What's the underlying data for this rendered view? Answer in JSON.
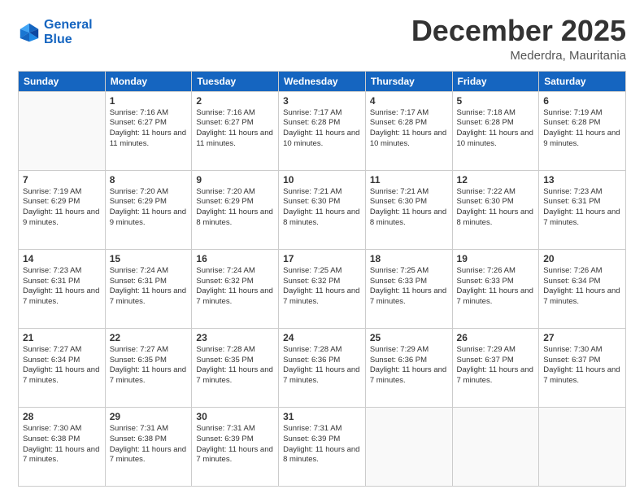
{
  "header": {
    "logo_line1": "General",
    "logo_line2": "Blue",
    "month": "December 2025",
    "location": "Mederdra, Mauritania"
  },
  "weekdays": [
    "Sunday",
    "Monday",
    "Tuesday",
    "Wednesday",
    "Thursday",
    "Friday",
    "Saturday"
  ],
  "weeks": [
    [
      {
        "day": "",
        "info": ""
      },
      {
        "day": "1",
        "info": "Sunrise: 7:16 AM\nSunset: 6:27 PM\nDaylight: 11 hours\nand 11 minutes."
      },
      {
        "day": "2",
        "info": "Sunrise: 7:16 AM\nSunset: 6:27 PM\nDaylight: 11 hours\nand 11 minutes."
      },
      {
        "day": "3",
        "info": "Sunrise: 7:17 AM\nSunset: 6:28 PM\nDaylight: 11 hours\nand 10 minutes."
      },
      {
        "day": "4",
        "info": "Sunrise: 7:17 AM\nSunset: 6:28 PM\nDaylight: 11 hours\nand 10 minutes."
      },
      {
        "day": "5",
        "info": "Sunrise: 7:18 AM\nSunset: 6:28 PM\nDaylight: 11 hours\nand 10 minutes."
      },
      {
        "day": "6",
        "info": "Sunrise: 7:19 AM\nSunset: 6:28 PM\nDaylight: 11 hours\nand 9 minutes."
      }
    ],
    [
      {
        "day": "7",
        "info": "Sunrise: 7:19 AM\nSunset: 6:29 PM\nDaylight: 11 hours\nand 9 minutes."
      },
      {
        "day": "8",
        "info": "Sunrise: 7:20 AM\nSunset: 6:29 PM\nDaylight: 11 hours\nand 9 minutes."
      },
      {
        "day": "9",
        "info": "Sunrise: 7:20 AM\nSunset: 6:29 PM\nDaylight: 11 hours\nand 8 minutes."
      },
      {
        "day": "10",
        "info": "Sunrise: 7:21 AM\nSunset: 6:30 PM\nDaylight: 11 hours\nand 8 minutes."
      },
      {
        "day": "11",
        "info": "Sunrise: 7:21 AM\nSunset: 6:30 PM\nDaylight: 11 hours\nand 8 minutes."
      },
      {
        "day": "12",
        "info": "Sunrise: 7:22 AM\nSunset: 6:30 PM\nDaylight: 11 hours\nand 8 minutes."
      },
      {
        "day": "13",
        "info": "Sunrise: 7:23 AM\nSunset: 6:31 PM\nDaylight: 11 hours\nand 7 minutes."
      }
    ],
    [
      {
        "day": "14",
        "info": "Sunrise: 7:23 AM\nSunset: 6:31 PM\nDaylight: 11 hours\nand 7 minutes."
      },
      {
        "day": "15",
        "info": "Sunrise: 7:24 AM\nSunset: 6:31 PM\nDaylight: 11 hours\nand 7 minutes."
      },
      {
        "day": "16",
        "info": "Sunrise: 7:24 AM\nSunset: 6:32 PM\nDaylight: 11 hours\nand 7 minutes."
      },
      {
        "day": "17",
        "info": "Sunrise: 7:25 AM\nSunset: 6:32 PM\nDaylight: 11 hours\nand 7 minutes."
      },
      {
        "day": "18",
        "info": "Sunrise: 7:25 AM\nSunset: 6:33 PM\nDaylight: 11 hours\nand 7 minutes."
      },
      {
        "day": "19",
        "info": "Sunrise: 7:26 AM\nSunset: 6:33 PM\nDaylight: 11 hours\nand 7 minutes."
      },
      {
        "day": "20",
        "info": "Sunrise: 7:26 AM\nSunset: 6:34 PM\nDaylight: 11 hours\nand 7 minutes."
      }
    ],
    [
      {
        "day": "21",
        "info": "Sunrise: 7:27 AM\nSunset: 6:34 PM\nDaylight: 11 hours\nand 7 minutes."
      },
      {
        "day": "22",
        "info": "Sunrise: 7:27 AM\nSunset: 6:35 PM\nDaylight: 11 hours\nand 7 minutes."
      },
      {
        "day": "23",
        "info": "Sunrise: 7:28 AM\nSunset: 6:35 PM\nDaylight: 11 hours\nand 7 minutes."
      },
      {
        "day": "24",
        "info": "Sunrise: 7:28 AM\nSunset: 6:36 PM\nDaylight: 11 hours\nand 7 minutes."
      },
      {
        "day": "25",
        "info": "Sunrise: 7:29 AM\nSunset: 6:36 PM\nDaylight: 11 hours\nand 7 minutes."
      },
      {
        "day": "26",
        "info": "Sunrise: 7:29 AM\nSunset: 6:37 PM\nDaylight: 11 hours\nand 7 minutes."
      },
      {
        "day": "27",
        "info": "Sunrise: 7:30 AM\nSunset: 6:37 PM\nDaylight: 11 hours\nand 7 minutes."
      }
    ],
    [
      {
        "day": "28",
        "info": "Sunrise: 7:30 AM\nSunset: 6:38 PM\nDaylight: 11 hours\nand 7 minutes."
      },
      {
        "day": "29",
        "info": "Sunrise: 7:31 AM\nSunset: 6:38 PM\nDaylight: 11 hours\nand 7 minutes."
      },
      {
        "day": "30",
        "info": "Sunrise: 7:31 AM\nSunset: 6:39 PM\nDaylight: 11 hours\nand 7 minutes."
      },
      {
        "day": "31",
        "info": "Sunrise: 7:31 AM\nSunset: 6:39 PM\nDaylight: 11 hours\nand 8 minutes."
      },
      {
        "day": "",
        "info": ""
      },
      {
        "day": "",
        "info": ""
      },
      {
        "day": "",
        "info": ""
      }
    ]
  ]
}
